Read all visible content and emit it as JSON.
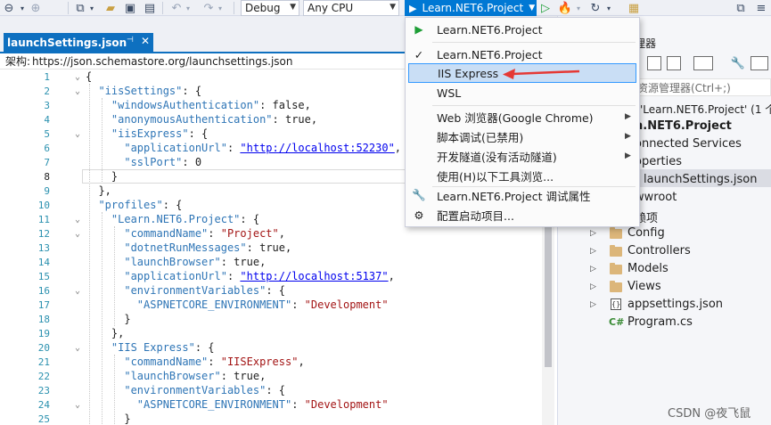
{
  "toolbar": {
    "config": "Debug",
    "platform": "Any CPU",
    "run_target": "Learn.NET6.Project"
  },
  "tab": {
    "title": "launchSettings.json",
    "pin": "⊣",
    "close": "✕"
  },
  "schema": {
    "label": "架构:",
    "url": "https://json.schemastore.org/launchsettings.json"
  },
  "editor": {
    "current_line": 8,
    "line_numbers": [
      "1",
      "2",
      "3",
      "4",
      "5",
      "6",
      "7",
      "8",
      "9",
      "10",
      "11",
      "12",
      "13",
      "14",
      "15",
      "16",
      "17",
      "18",
      "19",
      "20",
      "21",
      "22",
      "23",
      "24",
      "25"
    ]
  },
  "menu": {
    "items": [
      {
        "label": "Learn.NET6.Project",
        "icon": "play-icon"
      },
      {
        "label": "Learn.NET6.Project",
        "icon": "check-icon"
      },
      {
        "label": "IIS Express",
        "icon": ""
      },
      {
        "label": "WSL",
        "icon": ""
      },
      {
        "label": "Web 浏览器(Google Chrome)",
        "icon": "",
        "submenu": true
      },
      {
        "label": "脚本调试(已禁用)",
        "icon": "",
        "submenu": true
      },
      {
        "label": "开发隧道(没有活动隧道)",
        "icon": "",
        "submenu": true
      },
      {
        "label": "使用(H)以下工具浏览...",
        "icon": ""
      },
      {
        "label": "Learn.NET6.Project 调试属性",
        "icon": "wrench-icon"
      },
      {
        "label": "配置启动项目...",
        "icon": "gear-icon"
      }
    ],
    "highlighted_index": 2
  },
  "solution_explorer": {
    "title": "管理器",
    "search_placeholder": "资源管理器(Ctrl+;)",
    "solution_line": "'Learn.NET6.Project' (1 个",
    "project": "n.NET6.Project",
    "items": [
      {
        "label": "onnected Services"
      },
      {
        "label": "operties"
      },
      {
        "label": "launchSettings.json"
      },
      {
        "label": "wwroot"
      },
      {
        "label": "赖项"
      },
      {
        "label": "Config"
      },
      {
        "label": "Controllers"
      },
      {
        "label": "Models"
      },
      {
        "label": "Views"
      },
      {
        "label": "appsettings.json"
      },
      {
        "label": "Program.cs"
      }
    ]
  },
  "watermark": "CSDN @夜飞鼠",
  "colors": {
    "accent": "#0e70c0",
    "run_button": "#0078d4",
    "menu_highlight": "#c9def5",
    "arrow": "#e53935",
    "json_key": "#2e75b6",
    "json_string": "#a31515"
  }
}
